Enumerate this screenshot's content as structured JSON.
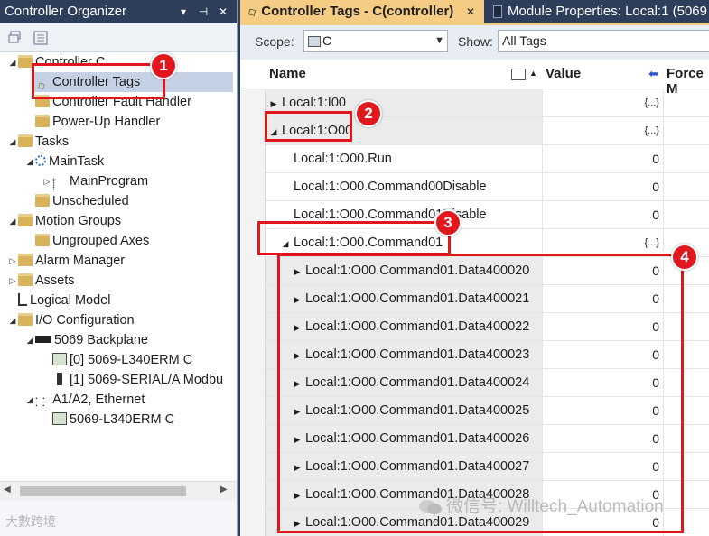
{
  "organizer": {
    "title": "Controller Organizer",
    "pin_glyph": "▾",
    "pin2_glyph": "⊣",
    "close_glyph": "✕",
    "tree": [
      {
        "label": "Controller C",
        "expander": "◢",
        "icon": "folder"
      },
      {
        "label": "Controller Tags",
        "expander": "",
        "icon": "tag"
      },
      {
        "label": "Controller Fault Handler",
        "expander": "",
        "icon": "folder"
      },
      {
        "label": "Power-Up Handler",
        "expander": "",
        "icon": "folder"
      },
      {
        "label": "Tasks",
        "expander": "◢",
        "icon": "folder"
      },
      {
        "label": "MainTask",
        "expander": "◢",
        "icon": "task"
      },
      {
        "label": "MainProgram",
        "expander": "▷",
        "icon": "program"
      },
      {
        "label": "Unscheduled",
        "expander": "",
        "icon": "folder"
      },
      {
        "label": "Motion Groups",
        "expander": "◢",
        "icon": "folder"
      },
      {
        "label": "Ungrouped Axes",
        "expander": "",
        "icon": "folder"
      },
      {
        "label": "Alarm Manager",
        "expander": "▷",
        "icon": "folder"
      },
      {
        "label": "Assets",
        "expander": "▷",
        "icon": "folder"
      },
      {
        "label": "Logical Model",
        "expander": "",
        "icon": "model"
      },
      {
        "label": "I/O Configuration",
        "expander": "◢",
        "icon": "folder"
      },
      {
        "label": "5069 Backplane",
        "expander": "◢",
        "icon": "backplane"
      },
      {
        "label": "[0] 5069-L340ERM C",
        "expander": "",
        "icon": "module"
      },
      {
        "label": "[1] 5069-SERIAL/A Modbu",
        "expander": "",
        "icon": "module-small"
      },
      {
        "label": "A1/A2, Ethernet",
        "expander": "◢",
        "icon": "network"
      },
      {
        "label": "5069-L340ERM C",
        "expander": "",
        "icon": "module"
      }
    ],
    "scroll_left": "◀",
    "scroll_right": "▶"
  },
  "tabs": {
    "active_label": "Controller Tags - C(controller)",
    "active_close": "✕",
    "second_label": "Module Properties: Local:1 (5069"
  },
  "scope_bar": {
    "scope_label": "Scope:",
    "scope_value": "C",
    "show_label": "Show:",
    "show_value": "All Tags"
  },
  "grid": {
    "columns": [
      "Name",
      "Value",
      "Force M"
    ],
    "value_sort_glyph": "◆",
    "rows": [
      {
        "name": "Local:1:I00",
        "value": "{...}",
        "expander": "▶",
        "indent": 0
      },
      {
        "name": "Local:1:O00",
        "value": "{...}",
        "expander": "◢",
        "indent": 0
      },
      {
        "name": "Local:1:O00.Run",
        "value": "0",
        "expander": "",
        "indent": 1
      },
      {
        "name": "Local:1:O00.Command00Disable",
        "value": "0",
        "expander": "",
        "indent": 1
      },
      {
        "name": "Local:1:O00.Command01Disable",
        "value": "0",
        "expander": "",
        "indent": 1
      },
      {
        "name": "Local:1:O00.Command01",
        "value": "{...}",
        "expander": "◢",
        "indent": 1
      },
      {
        "name": "Local:1:O00.Command01.Data400020",
        "value": "0",
        "expander": "▶",
        "indent": 2
      },
      {
        "name": "Local:1:O00.Command01.Data400021",
        "value": "0",
        "expander": "▶",
        "indent": 2
      },
      {
        "name": "Local:1:O00.Command01.Data400022",
        "value": "0",
        "expander": "▶",
        "indent": 2
      },
      {
        "name": "Local:1:O00.Command01.Data400023",
        "value": "0",
        "expander": "▶",
        "indent": 2
      },
      {
        "name": "Local:1:O00.Command01.Data400024",
        "value": "0",
        "expander": "▶",
        "indent": 2
      },
      {
        "name": "Local:1:O00.Command01.Data400025",
        "value": "0",
        "expander": "▶",
        "indent": 2
      },
      {
        "name": "Local:1:O00.Command01.Data400026",
        "value": "0",
        "expander": "▶",
        "indent": 2
      },
      {
        "name": "Local:1:O00.Command01.Data400027",
        "value": "0",
        "expander": "▶",
        "indent": 2
      },
      {
        "name": "Local:1:O00.Command01.Data400028",
        "value": "0",
        "expander": "▶",
        "indent": 2
      },
      {
        "name": "Local:1:O00.Command01.Data400029",
        "value": "0",
        "expander": "▶",
        "indent": 2
      }
    ]
  },
  "annotations": {
    "badges": [
      "1",
      "2",
      "3",
      "4"
    ],
    "color": "#e0171c"
  },
  "watermark": "微信号: Willtech_Automation",
  "footer_mark": "大數跨境",
  "colors": {
    "titlebar": "#2d3e5b",
    "active_tab": "#f5cc84",
    "selection": "#c5d2e6"
  }
}
